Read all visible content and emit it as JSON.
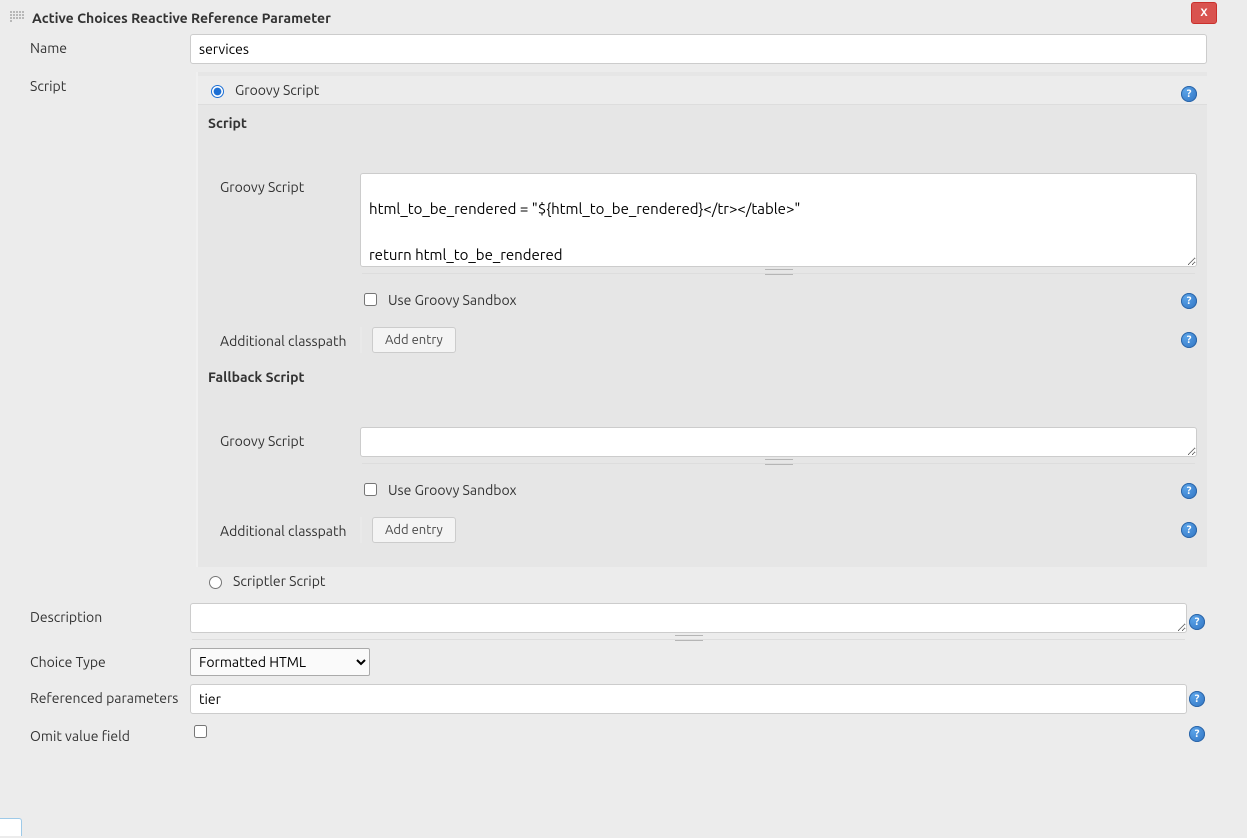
{
  "section": {
    "title": "Active Choices Reactive Reference Parameter",
    "delete_label": "X"
  },
  "labels": {
    "name": "Name",
    "script": "Script",
    "description": "Description",
    "choice_type": "Choice Type",
    "referenced_parameters": "Referenced parameters",
    "omit_value_field": "Omit value field"
  },
  "name": {
    "value": "services"
  },
  "radios": {
    "groovy": "Groovy Script",
    "scriptler": "Scriptler Script"
  },
  "script_block": {
    "title": "Script",
    "groovy_label": "Groovy Script",
    "groovy_value": "}\n\nhtml_to_be_rendered = \"${html_to_be_rendered}</tr></table>\"\n\nreturn html_to_be_rendered",
    "sandbox_label": "Use Groovy Sandbox",
    "sandbox_checked": false,
    "classpath_label": "Additional classpath",
    "add_entry": "Add entry"
  },
  "fallback_block": {
    "title": "Fallback Script",
    "groovy_label": "Groovy Script",
    "groovy_value": "",
    "sandbox_label": "Use Groovy Sandbox",
    "sandbox_checked": false,
    "classpath_label": "Additional classpath",
    "add_entry": "Add entry"
  },
  "description": {
    "value": ""
  },
  "choice_type": {
    "value": "Formatted HTML"
  },
  "referenced_parameters": {
    "value": "tier"
  },
  "omit_value_field": {
    "checked": false
  }
}
